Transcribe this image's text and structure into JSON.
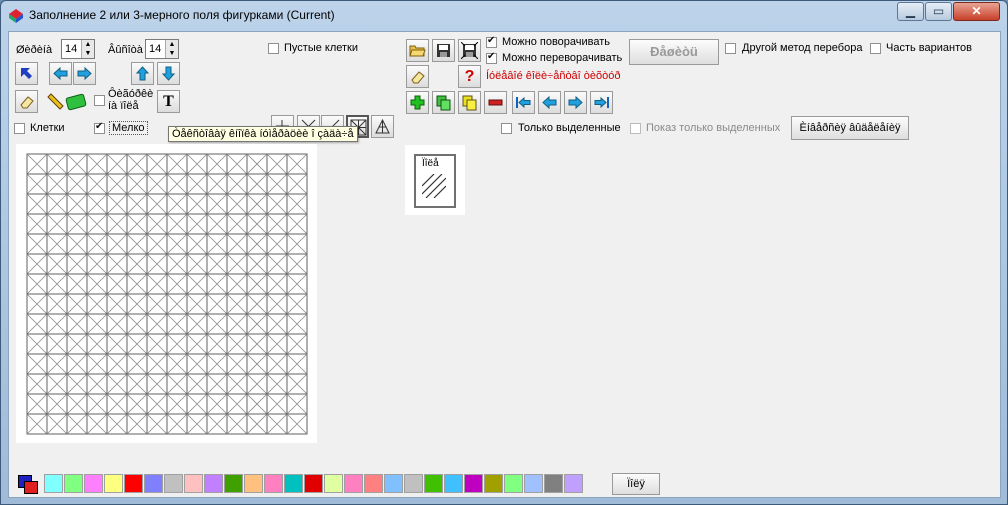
{
  "window": {
    "title": "Заполнение 2 или 3-мерного поля фигурками (Current)"
  },
  "controls": {
    "width_label": "Øèðèíà",
    "width_value": "14",
    "height_label": "Âûñîòà",
    "height_value": "14",
    "empty_cells_label": "Пустые клетки",
    "frame_label": "Ôèãóðêè",
    "frame_label2": "íà ïîëå",
    "text_tool": "T",
    "cells_label": "Клетки",
    "fine_label": "Мелко",
    "tooltip": "Òåêñòîâàÿ êíîïêà íóìåðàöèè î çàäà÷å"
  },
  "options": {
    "can_rotate": "Можно поворачивать",
    "can_flip": "Можно переворачивать",
    "hint_red": "Íóëåâîé êîëè÷åñòâî òèõòóð",
    "solve_button": "Ðåøèòü",
    "other_method": "Другой метод перебора",
    "part_variants": "Часть вариантов",
    "only_selected": "Только выделенные",
    "show_only_selected": "Показ только выделенных",
    "select_all_button": "Èíâåðñèÿ âûäåëåíèÿ"
  },
  "piece_preview": {
    "label": "Ïîëå"
  },
  "palette": {
    "colors": [
      "#80ffff",
      "#80ff80",
      "#ff80ff",
      "#ffff80",
      "#ff0000",
      "#8080ff",
      "#c0c0c0",
      "#ffc0c0",
      "#c080ff",
      "#40a000",
      "#ffc080",
      "#ff80c0",
      "#00c0c0",
      "#e00000",
      "#e0ffa0",
      "#ff80c0",
      "#ff8080",
      "#80c0ff",
      "#c0c0c0",
      "#40c000",
      "#40c0ff",
      "#c000c0",
      "#a0a000",
      "#80ff80",
      "#a0c0ff",
      "#808080",
      "#c0a0ff"
    ],
    "grid_button": "Ïîëÿ"
  },
  "grid": {
    "cols": 14,
    "rows": 14
  }
}
